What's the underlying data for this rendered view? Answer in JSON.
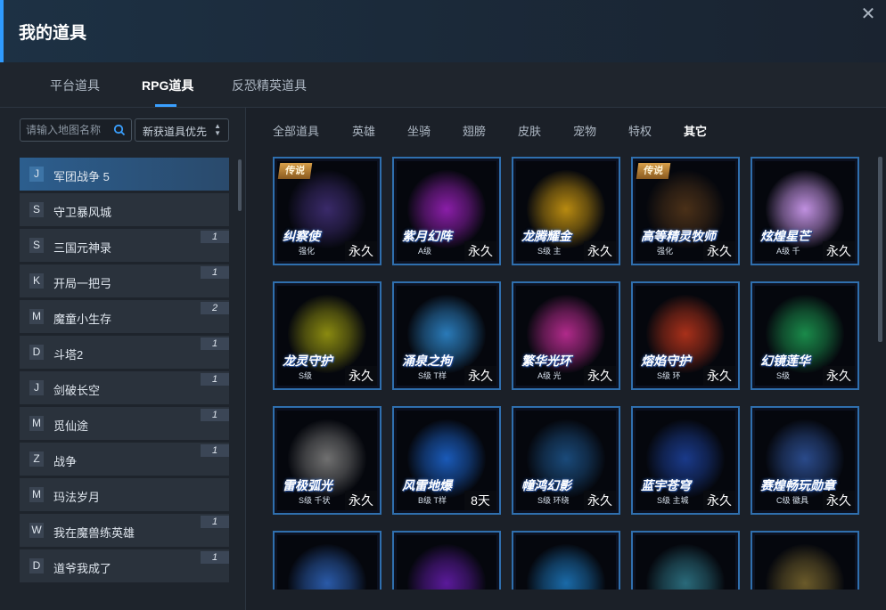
{
  "window": {
    "title": "我的道具",
    "close_symbol": "✕"
  },
  "tabs": [
    {
      "label": "平台道具"
    },
    {
      "label": "RPG道具",
      "active": true
    },
    {
      "label": "反恐精英道具"
    }
  ],
  "search": {
    "placeholder": "请输入地图名称",
    "value": ""
  },
  "sort": {
    "selected": "新获道具优先"
  },
  "maps": [
    {
      "letter": "J",
      "name": "军团战争 5",
      "badge": "",
      "active": true
    },
    {
      "letter": "S",
      "name": "守卫暴风城",
      "badge": ""
    },
    {
      "letter": "S",
      "name": "三国元神录",
      "badge": "1"
    },
    {
      "letter": "K",
      "name": "开局一把弓",
      "badge": "1"
    },
    {
      "letter": "M",
      "name": "魔童小生存",
      "badge": "2"
    },
    {
      "letter": "D",
      "name": "斗塔2",
      "badge": "1"
    },
    {
      "letter": "J",
      "name": "剑破长空",
      "badge": "1"
    },
    {
      "letter": "M",
      "name": "觅仙途",
      "badge": "1"
    },
    {
      "letter": "Z",
      "name": "战争",
      "badge": "1"
    },
    {
      "letter": "M",
      "name": "玛法岁月",
      "badge": ""
    },
    {
      "letter": "W",
      "name": "我在魔兽练英雄",
      "badge": "1"
    },
    {
      "letter": "D",
      "name": "道爷我成了",
      "badge": "1"
    }
  ],
  "categories": [
    {
      "label": "全部道具"
    },
    {
      "label": "英雄"
    },
    {
      "label": "坐骑"
    },
    {
      "label": "翅膀"
    },
    {
      "label": "皮肤"
    },
    {
      "label": "宠物"
    },
    {
      "label": "特权"
    },
    {
      "label": "其它",
      "active": true
    }
  ],
  "items": [
    {
      "name": "纠察使",
      "sub": "强化",
      "duration": "永久",
      "ribbon": "传说",
      "color": "#3a2a6a"
    },
    {
      "name": "紫月幻阵",
      "sub": "A级 ",
      "duration": "永久",
      "ribbon": "",
      "color": "#8a1ea8"
    },
    {
      "name": "龙腾耀金",
      "sub": "S级 主",
      "duration": "永久",
      "ribbon": "",
      "color": "#b88a10"
    },
    {
      "name": "高等精灵牧师",
      "sub": "强化",
      "duration": "永久",
      "ribbon": "传说",
      "color": "#4a3018"
    },
    {
      "name": "炫煌星芒",
      "sub": "A级 千",
      "duration": "永久",
      "ribbon": "",
      "color": "#c090e0"
    },
    {
      "name": "龙灵守护",
      "sub": "S级 ",
      "duration": "永久",
      "ribbon": "",
      "color": "#8a8a10"
    },
    {
      "name": "涌泉之拘",
      "sub": "S级 T样",
      "duration": "永久",
      "ribbon": "",
      "color": "#2a7ab8"
    },
    {
      "name": "繁华光环",
      "sub": "A级 光",
      "duration": "永久",
      "ribbon": "",
      "color": "#b02a8a"
    },
    {
      "name": "熔焰守护",
      "sub": "S级 环",
      "duration": "永久",
      "ribbon": "",
      "color": "#a8301a"
    },
    {
      "name": "幻镜莲华",
      "sub": "S级 ",
      "duration": "永久",
      "ribbon": "",
      "color": "#1a8a4a"
    },
    {
      "name": "雷极弧光",
      "sub": "S级 千状",
      "duration": "永久",
      "ribbon": "",
      "color": "#707070"
    },
    {
      "name": "风雷地爆",
      "sub": "B级 T样",
      "duration": "8天",
      "ribbon": "",
      "color": "#1a5ab8"
    },
    {
      "name": "幢鸿幻影",
      "sub": "S级 环绕",
      "duration": "永久",
      "ribbon": "",
      "color": "#1a4a7a"
    },
    {
      "name": "蓝宇苍穹",
      "sub": "S级 主城",
      "duration": "永久",
      "ribbon": "",
      "color": "#1a3a8a"
    },
    {
      "name": "赛煌畅玩勋章",
      "sub": "C级 徽具",
      "duration": "永久",
      "ribbon": "",
      "color": "#2a4a8a"
    },
    {
      "name": "",
      "sub": "",
      "duration": "",
      "ribbon": "",
      "color": "#2a5aa8"
    },
    {
      "name": "",
      "sub": "",
      "duration": "",
      "ribbon": "",
      "color": "#5a1a9a"
    },
    {
      "name": "",
      "sub": "",
      "duration": "",
      "ribbon": "",
      "color": "#1a6aa8"
    },
    {
      "name": "",
      "sub": "",
      "duration": "",
      "ribbon": "",
      "color": "#2a6a7a"
    },
    {
      "name": "",
      "sub": "",
      "duration": "",
      "ribbon": "",
      "color": "#6a5a2a"
    }
  ]
}
